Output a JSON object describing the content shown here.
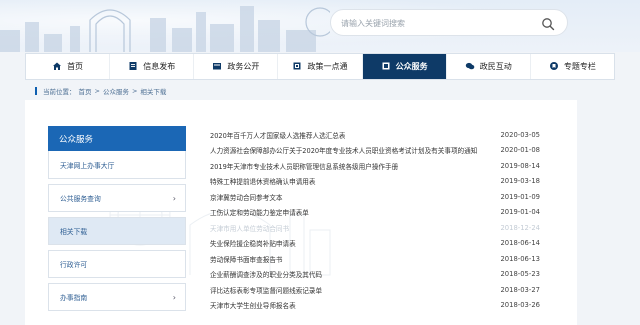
{
  "search": {
    "placeholder": "请输入关键词搜索"
  },
  "nav": [
    {
      "label": "首页",
      "icon": "home-icon"
    },
    {
      "label": "信息发布",
      "icon": "document-icon"
    },
    {
      "label": "政务公开",
      "icon": "folder-icon"
    },
    {
      "label": "政策一点通",
      "icon": "book-icon"
    },
    {
      "label": "公众服务",
      "icon": "service-icon",
      "active": true
    },
    {
      "label": "政民互动",
      "icon": "chat-icon"
    },
    {
      "label": "专题专栏",
      "icon": "bookmark-icon"
    }
  ],
  "breadcrumb": {
    "prefix": "当前位置：",
    "items": [
      "首页",
      "公众服务",
      "相关下载"
    ],
    "separator": ">"
  },
  "sidebar": {
    "title": "公众服务",
    "items": [
      {
        "label": "天津网上办事大厅",
        "arrow": false
      },
      {
        "label": "公共服务查询",
        "arrow": true
      },
      {
        "label": "相关下载",
        "arrow": false,
        "active": true
      },
      {
        "label": "行政许可",
        "arrow": false
      },
      {
        "label": "办事指南",
        "arrow": true
      }
    ]
  },
  "list": [
    {
      "title": "2020年百千万人才国家级人选推荐人选汇总表",
      "date": "2020-03-05"
    },
    {
      "title": "人力资源社会保障部办公厅关于2020年度专业技术人员职业资格考试计划及有关事项的通知",
      "date": "2020-01-08"
    },
    {
      "title": "2019年天津市专业技术人员职称管理信息系统各级用户操作手册",
      "date": "2019-08-14"
    },
    {
      "title": "特殊工种提前退休资格确认申请用表",
      "date": "2019-03-18"
    },
    {
      "title": "京津冀劳动合同参考文本",
      "date": "2019-01-09"
    },
    {
      "title": "工伤认定和劳动能力鉴定申请表单",
      "date": "2019-01-04"
    },
    {
      "title": "天津市用人单位劳动合同书",
      "date": "2018-12-24",
      "faded": true
    },
    {
      "title": "失业保险援企稳岗补贴申请表",
      "date": "2018-06-14"
    },
    {
      "title": "劳动保障书面审查报告书",
      "date": "2018-06-13"
    },
    {
      "title": "企业薪酬调查涉及的职业分类及其代码",
      "date": "2018-05-23"
    },
    {
      "title": "评比达标表彰专项监督问题线索记录单",
      "date": "2018-03-27"
    },
    {
      "title": "天津市大学生创业导师报名表",
      "date": "2018-03-26"
    }
  ],
  "colors": {
    "nav_active": "#0e3a67",
    "sidebar_head": "#1b67b5",
    "link_text": "#2e5e93"
  }
}
